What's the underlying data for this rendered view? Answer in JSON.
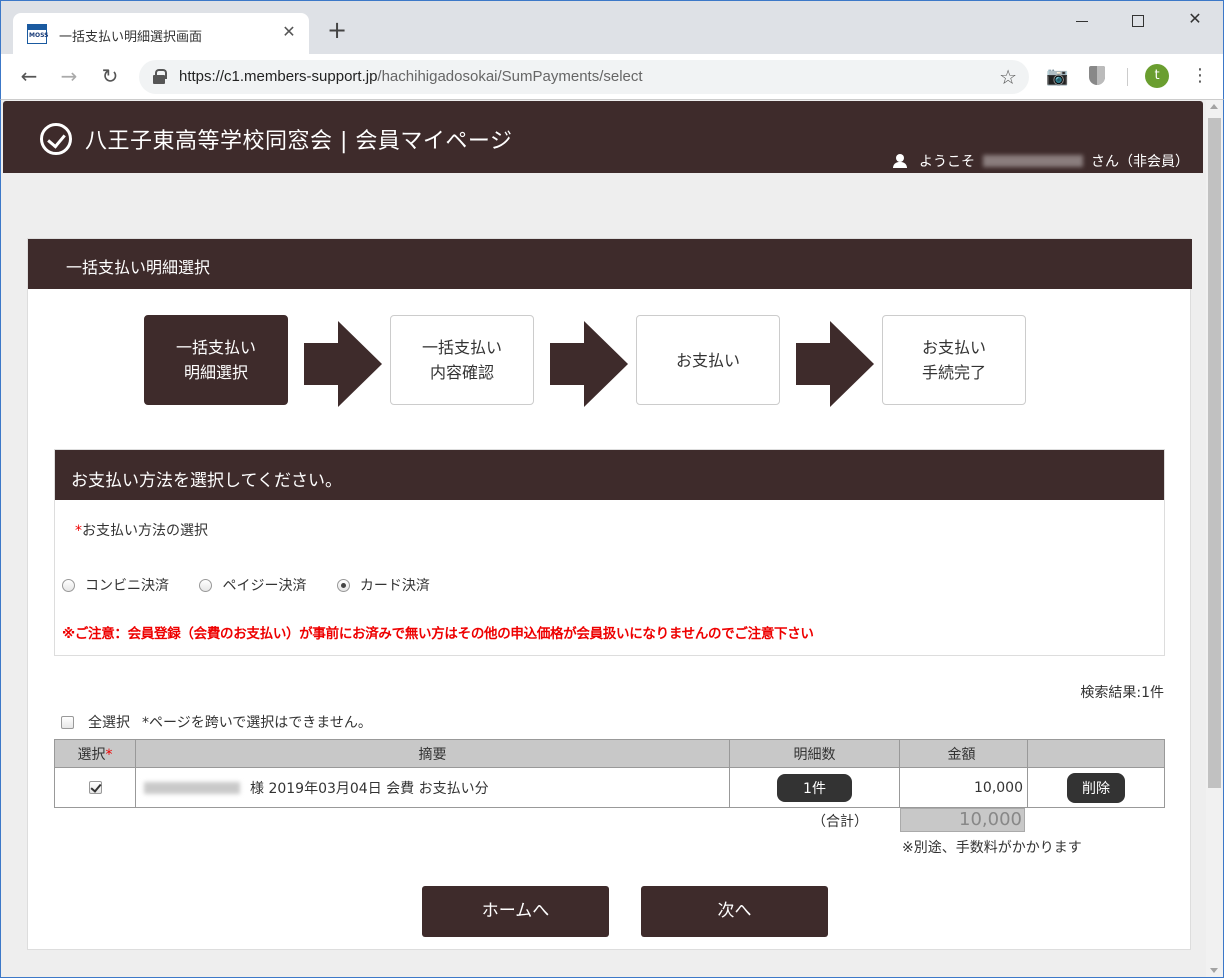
{
  "browser": {
    "tab_title": "一括支払い明細選択画面",
    "favicon_text": "MOSS",
    "tab_close": "✕",
    "new_tab": "+",
    "url_host": "https://c1.members-support.jp",
    "url_path": "/hachihigadosokai/SumPayments/select",
    "avatar_letter": "t",
    "icons": {
      "back": "←",
      "forward": "→",
      "reload": "↻",
      "star": "☆",
      "camera": "📷",
      "menu": "⋮",
      "close": "✕"
    }
  },
  "header": {
    "site_title": "八王子東高等学校同窓会 | 会員マイページ",
    "welcome_prefix": "ようこそ",
    "welcome_suffix": "さん（非会員）"
  },
  "page": {
    "section_title": "一括支払い明細選択",
    "steps": [
      {
        "label": "一括支払い\n明細選択",
        "active": true
      },
      {
        "label": "一括支払い\n内容確認",
        "active": false
      },
      {
        "label": "お支払い",
        "active": false
      },
      {
        "label": "お支払い\n手続完了",
        "active": false
      }
    ]
  },
  "payment": {
    "title": "お支払い方法を選択してください。",
    "required_mark": "*",
    "method_label": "お支払い方法の選択",
    "methods": [
      {
        "label": "コンビニ決済",
        "selected": false
      },
      {
        "label": "ペイジー決済",
        "selected": false
      },
      {
        "label": "カード決済",
        "selected": true
      }
    ],
    "notice": "※ご注意：会員登録（会費のお支払い）が事前にお済みで無い方はその他の申込価格が会員扱いになりませんのでご注意下さい"
  },
  "results": {
    "count_text": "検索結果:1件",
    "select_all_label": "全選択",
    "select_hint": "*ページを跨いで選択はできません。",
    "columns": [
      "選択",
      "摘要",
      "明細数",
      "金額",
      ""
    ],
    "required_mark": "*",
    "rows": [
      {
        "checked": true,
        "summary": "様 2019年03月04日 会費 お支払い分",
        "count": "1件",
        "amount": "10,000",
        "delete_label": "削除"
      }
    ],
    "total_label": "（合計）",
    "total_value": "10,000",
    "fee_note": "※別途、手数料がかかります"
  },
  "buttons": {
    "home": "ホームへ",
    "next": "次へ"
  },
  "colors": {
    "brand_dark": "#3e2b2b",
    "notice_red": "#e00000",
    "avatar_green": "#6a9e2f"
  }
}
